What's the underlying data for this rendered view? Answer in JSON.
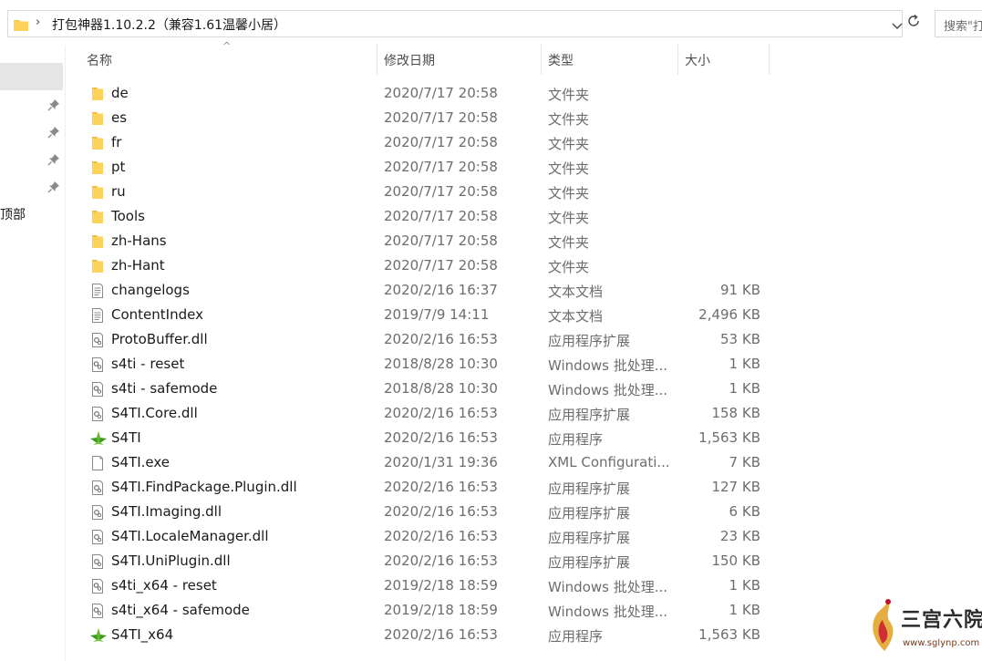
{
  "address": {
    "path": "打包神器1.10.2.2（兼容1.61温馨小居）",
    "search_placeholder": "搜索\"打"
  },
  "nav": {
    "partial_item": "顶部"
  },
  "columns": {
    "name": "名称",
    "date": "修改日期",
    "type": "类型",
    "size": "大小"
  },
  "files": [
    {
      "name": "de",
      "date": "2020/7/17 20:58",
      "type": "文件夹",
      "size": "",
      "icon": "folder-icon"
    },
    {
      "name": "es",
      "date": "2020/7/17 20:58",
      "type": "文件夹",
      "size": "",
      "icon": "folder-icon"
    },
    {
      "name": "fr",
      "date": "2020/7/17 20:58",
      "type": "文件夹",
      "size": "",
      "icon": "folder-icon"
    },
    {
      "name": "pt",
      "date": "2020/7/17 20:58",
      "type": "文件夹",
      "size": "",
      "icon": "folder-icon"
    },
    {
      "name": "ru",
      "date": "2020/7/17 20:58",
      "type": "文件夹",
      "size": "",
      "icon": "folder-icon"
    },
    {
      "name": "Tools",
      "date": "2020/7/17 20:58",
      "type": "文件夹",
      "size": "",
      "icon": "folder-icon"
    },
    {
      "name": "zh-Hans",
      "date": "2020/7/17 20:58",
      "type": "文件夹",
      "size": "",
      "icon": "folder-icon"
    },
    {
      "name": "zh-Hant",
      "date": "2020/7/17 20:58",
      "type": "文件夹",
      "size": "",
      "icon": "folder-icon"
    },
    {
      "name": "changelogs",
      "date": "2020/2/16 16:37",
      "type": "文本文档",
      "size": "91 KB",
      "icon": "text-document-icon"
    },
    {
      "name": "ContentIndex",
      "date": "2019/7/9 14:11",
      "type": "文本文档",
      "size": "2,496 KB",
      "icon": "text-document-icon"
    },
    {
      "name": "ProtoBuffer.dll",
      "date": "2020/2/16 16:53",
      "type": "应用程序扩展",
      "size": "53 KB",
      "icon": "dll-icon"
    },
    {
      "name": "s4ti - reset",
      "date": "2018/8/28 10:30",
      "type": "Windows 批处理...",
      "size": "1 KB",
      "icon": "batch-file-icon"
    },
    {
      "name": "s4ti - safemode",
      "date": "2018/8/28 10:30",
      "type": "Windows 批处理...",
      "size": "1 KB",
      "icon": "batch-file-icon"
    },
    {
      "name": "S4TI.Core.dll",
      "date": "2020/2/16 16:53",
      "type": "应用程序扩展",
      "size": "158 KB",
      "icon": "dll-icon"
    },
    {
      "name": "S4TI",
      "date": "2020/2/16 16:53",
      "type": "应用程序",
      "size": "1,563 KB",
      "icon": "s4ti-app-icon"
    },
    {
      "name": "S4TI.exe",
      "date": "2020/1/31 19:36",
      "type": "XML Configurati...",
      "size": "7 KB",
      "icon": "blank-file-icon"
    },
    {
      "name": "S4TI.FindPackage.Plugin.dll",
      "date": "2020/2/16 16:53",
      "type": "应用程序扩展",
      "size": "127 KB",
      "icon": "dll-icon"
    },
    {
      "name": "S4TI.Imaging.dll",
      "date": "2020/2/16 16:53",
      "type": "应用程序扩展",
      "size": "6 KB",
      "icon": "dll-icon"
    },
    {
      "name": "S4TI.LocaleManager.dll",
      "date": "2020/2/16 16:53",
      "type": "应用程序扩展",
      "size": "23 KB",
      "icon": "dll-icon"
    },
    {
      "name": "S4TI.UniPlugin.dll",
      "date": "2020/2/16 16:53",
      "type": "应用程序扩展",
      "size": "150 KB",
      "icon": "dll-icon"
    },
    {
      "name": "s4ti_x64 - reset",
      "date": "2019/2/18 18:59",
      "type": "Windows 批处理...",
      "size": "1 KB",
      "icon": "batch-file-icon"
    },
    {
      "name": "s4ti_x64 - safemode",
      "date": "2019/2/18 18:59",
      "type": "Windows 批处理...",
      "size": "1 KB",
      "icon": "batch-file-icon"
    },
    {
      "name": "S4TI_x64",
      "date": "2020/2/16 16:53",
      "type": "应用程序",
      "size": "1,563 KB",
      "icon": "s4ti-app-icon"
    }
  ],
  "watermark": {
    "text": "三宫六院",
    "url": "www.sglynp.com"
  },
  "colors": {
    "folder": "#f7c948",
    "app_green": "#4caf2a"
  }
}
